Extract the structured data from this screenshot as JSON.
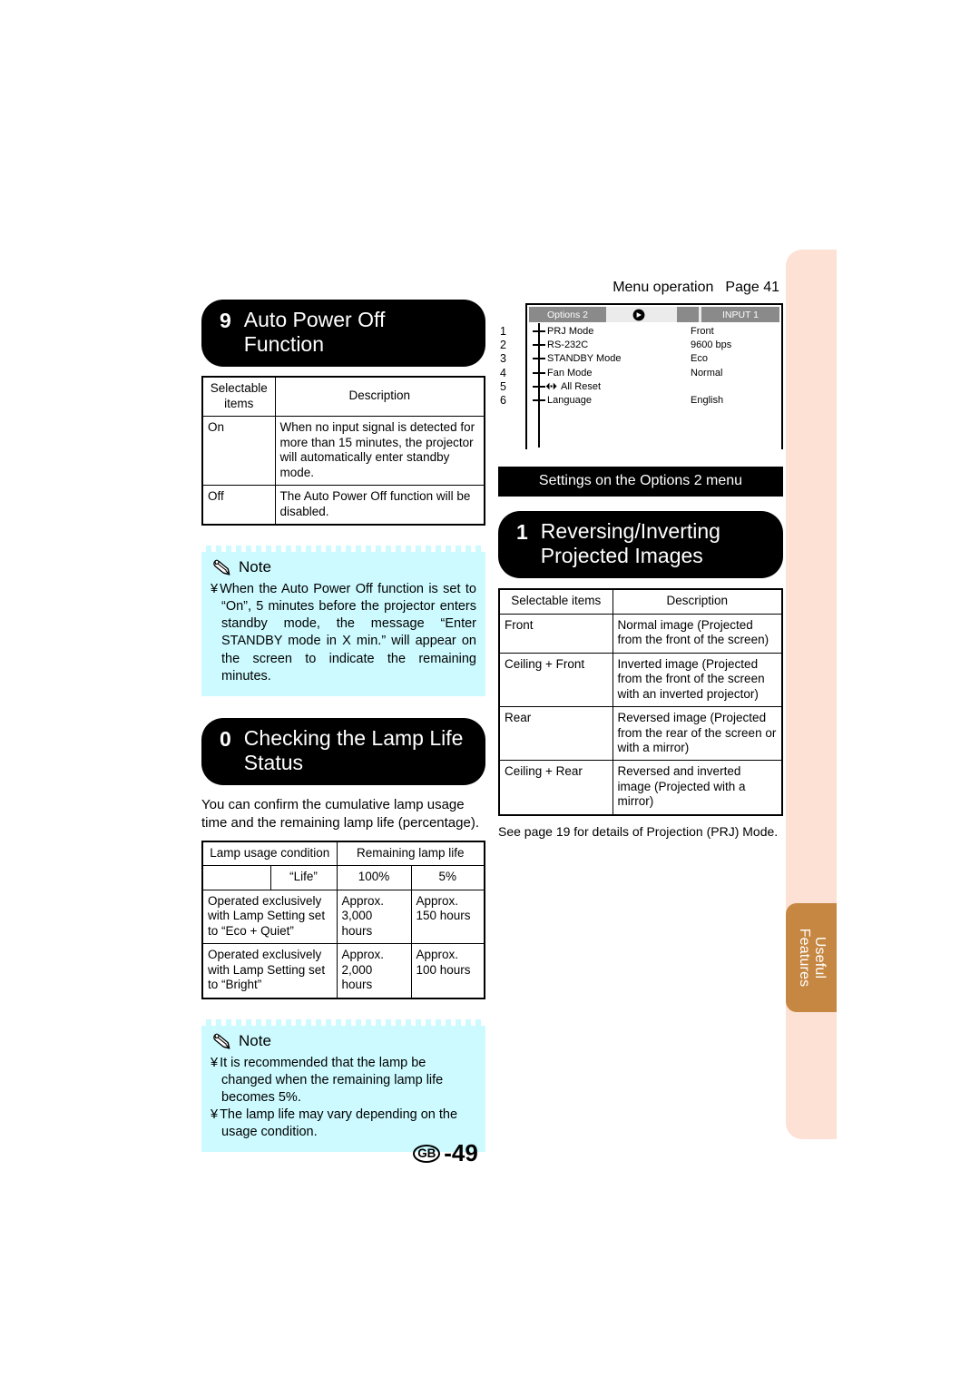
{
  "side_tab": {
    "label": "Useful\nFeatures",
    "color": "#c68742"
  },
  "page_footer": {
    "region": "GB",
    "number": "-49"
  },
  "left_column": {
    "section9": {
      "number": "9",
      "title": "Auto Power Off\nFunction",
      "table": {
        "headers": [
          "Selectable\nitems",
          "Description"
        ],
        "rows": [
          [
            "On",
            "When no input signal is detected for more than 15 minutes, the projector will automatically enter standby mode."
          ],
          [
            "Off",
            "The Auto Power Off function will be disabled."
          ]
        ]
      },
      "note": {
        "title": "Note",
        "items": [
          "When the Auto Power Off function is set to “On”, 5 minutes before the projector enters standby mode, the message “Enter STANDBY mode in X min.” will appear on the screen to indicate the remaining minutes."
        ]
      }
    },
    "section10": {
      "number": "0",
      "title": "Checking the Lamp Life\nStatus",
      "intro": "You can confirm the cumulative lamp usage time and the remaining lamp life (percentage).",
      "table": {
        "header_row1": [
          "Lamp usage condition",
          "Remaining lamp life"
        ],
        "header_row2": [
          "",
          "“Life”",
          "100%",
          "5%"
        ],
        "rows": [
          [
            "Operated exclusively with Lamp Setting set to “Eco + Quiet”",
            "Approx. 3,000 hours",
            "Approx. 150 hours"
          ],
          [
            "Operated exclusively with Lamp Setting set to “Bright”",
            "Approx. 2,000 hours",
            "Approx. 100 hours"
          ]
        ]
      },
      "note": {
        "title": "Note",
        "items": [
          "It is recommended that the lamp be changed when the remaining lamp life becomes 5%.",
          "The lamp life may vary depending on the usage condition."
        ]
      }
    }
  },
  "right_column": {
    "menu_operation_label": "Menu operation",
    "menu_operation_page": "Page 41",
    "osd": {
      "tab_name": "Options 2",
      "icon": "right-arrow-icon",
      "input_label": "INPUT 1",
      "rows": [
        {
          "num": "1",
          "label": "PRJ Mode",
          "value": "Front"
        },
        {
          "num": "2",
          "label": "RS-232C",
          "value": "9600 bps"
        },
        {
          "num": "3",
          "label": "STANDBY Mode",
          "value": "Eco"
        },
        {
          "num": "4",
          "label": "Fan Mode",
          "value": "Normal"
        },
        {
          "num": "5",
          "label": "All Reset",
          "value": ""
        },
        {
          "num": "6",
          "label": "Language",
          "value": "English"
        }
      ]
    },
    "banner": "Settings on the Options 2 menu",
    "section1": {
      "number": "1",
      "title": "Reversing/Inverting\nProjected Images",
      "table": {
        "headers": [
          "Selectable items",
          "Description"
        ],
        "rows": [
          [
            "Front",
            "Normal image (Projected from the front of the screen)"
          ],
          [
            "Ceiling + Front",
            "Inverted image (Projected from the front of the screen with an inverted projector)"
          ],
          [
            "Rear",
            "Reversed image (Projected from the rear of the screen or with a mirror)"
          ],
          [
            "Ceiling + Rear",
            "Reversed and inverted image (Projected with a mirror)"
          ]
        ]
      },
      "footnote": "See page 19 for details of Projection (PRJ) Mode."
    }
  }
}
